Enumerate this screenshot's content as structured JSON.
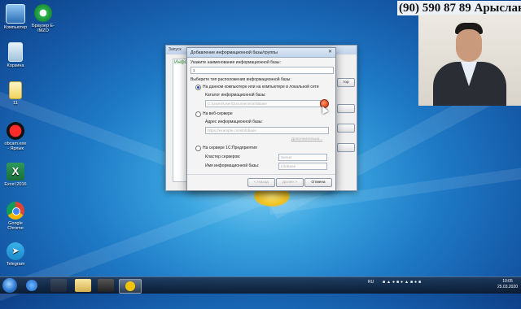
{
  "phone_overlay": "(90) 590 87 89 Арыслан",
  "desktop_icons": [
    {
      "label": "Компьютер"
    },
    {
      "label": "Браузер E-IMZO"
    },
    {
      "label": "Корзина"
    },
    {
      "label": "11"
    },
    {
      "label": "obcam.exe - Ярлык"
    },
    {
      "label": "Excel 2016"
    },
    {
      "label": "Google Chrome"
    },
    {
      "label": "Telegram"
    }
  ],
  "back_window": {
    "title": "Запуск",
    "side_label": "Инфо",
    "right_button": "тор"
  },
  "dialog": {
    "title": "Добавление информационной базы/группы",
    "name_prompt": "Укажите наименование информационной базы:",
    "name_value": "1",
    "location_prompt": "Выберите тип расположения информационной базы:",
    "options": {
      "local": "На данном компьютере или на компьютере в локальной сети",
      "web": "На веб-сервере",
      "server": "На сервере 1С:Предприятия"
    },
    "catalog_label": "Каталог информационной базы:",
    "catalog_placeholder": "C:\\Users\\User\\Documents\\InfoBase",
    "address_label": "Адрес информационной базы:",
    "address_placeholder": "https://example.com/infobase",
    "more_link": "Дополнительно...",
    "cluster_label": "Кластер серверов:",
    "cluster_placeholder": "Server",
    "dbname_label": "Имя информационной базы:",
    "dbname_placeholder": "InfoBase",
    "back_button": "< Назад",
    "next_button": "Далее >",
    "cancel_button": "Отмена"
  },
  "taskbar": {
    "lang": "RU",
    "time": "10:05",
    "date": "25.03.2020"
  }
}
